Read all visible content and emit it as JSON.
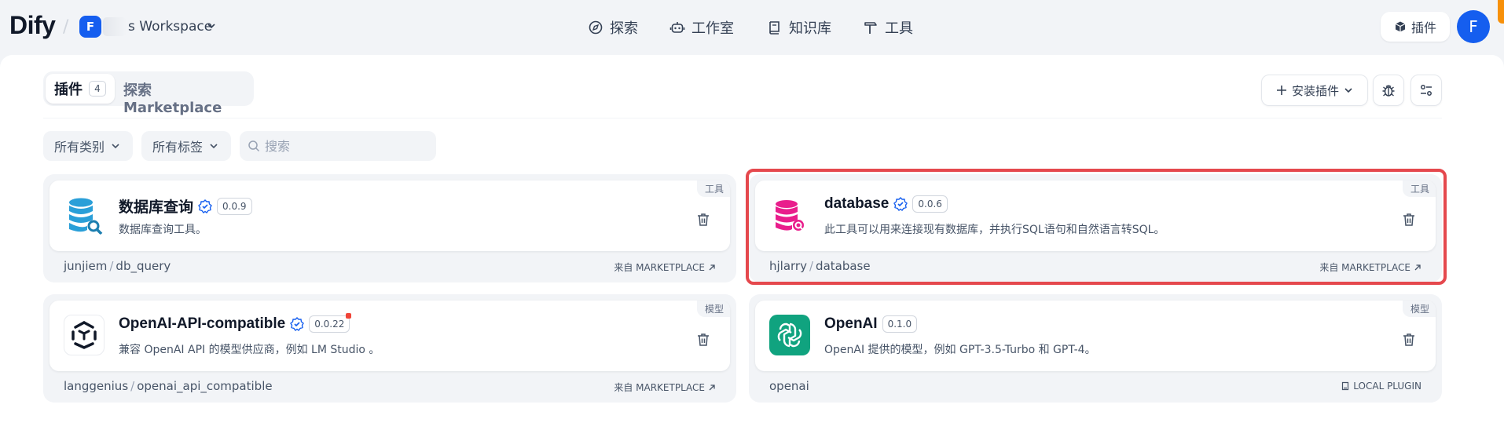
{
  "header": {
    "logo": "Dify",
    "workspace_initial": "F",
    "workspace_name": "s Workspace",
    "nav": [
      {
        "label": "探索",
        "icon": "compass-icon"
      },
      {
        "label": "工作室",
        "icon": "robot-icon"
      },
      {
        "label": "知识库",
        "icon": "book-icon"
      },
      {
        "label": "工具",
        "icon": "hammer-icon"
      }
    ],
    "plugin_button": "插件",
    "user_initial": "F"
  },
  "toolbar": {
    "tab_plugins": "插件",
    "tab_plugins_count": "4",
    "tab_marketplace": "探索 Marketplace",
    "install_button": "安装插件",
    "filter_category": "所有类别",
    "filter_tags": "所有标签",
    "search_placeholder": "搜索"
  },
  "plugins": [
    {
      "name": "数据库查询",
      "version": "0.0.9",
      "description": "数据库查询工具。",
      "tag": "工具",
      "author": "junjiem",
      "id": "db_query",
      "source": "来自 MARKETPLACE",
      "icon": "database-search-blue-icon"
    },
    {
      "name": "database",
      "version": "0.0.6",
      "description": "此工具可以用来连接现有数据库，并执行SQL语句和自然语言转SQL。",
      "tag": "工具",
      "author": "hjlarry",
      "id": "database",
      "source": "来自 MARKETPLACE",
      "icon": "database-search-pink-icon"
    },
    {
      "name": "OpenAI-API-compatible",
      "version": "0.0.22",
      "description": "兼容 OpenAI API 的模型供应商，例如 LM Studio 。",
      "tag": "模型",
      "author": "langgenius",
      "id": "openai_api_compatible",
      "source": "来自 MARKETPLACE",
      "icon": "api-compatible-icon"
    },
    {
      "name": "OpenAI",
      "version": "0.1.0",
      "description": "OpenAI 提供的模型，例如 GPT-3.5-Turbo 和 GPT-4。",
      "tag": "模型",
      "author": "openai",
      "id": "",
      "source": "LOCAL PLUGIN",
      "icon": "openai-icon"
    }
  ],
  "colors": {
    "accent": "#155eef",
    "highlight": "#e5484d",
    "verified": "#155eef",
    "openai_green": "#10a37f",
    "database_pink": "#e91e8c"
  }
}
